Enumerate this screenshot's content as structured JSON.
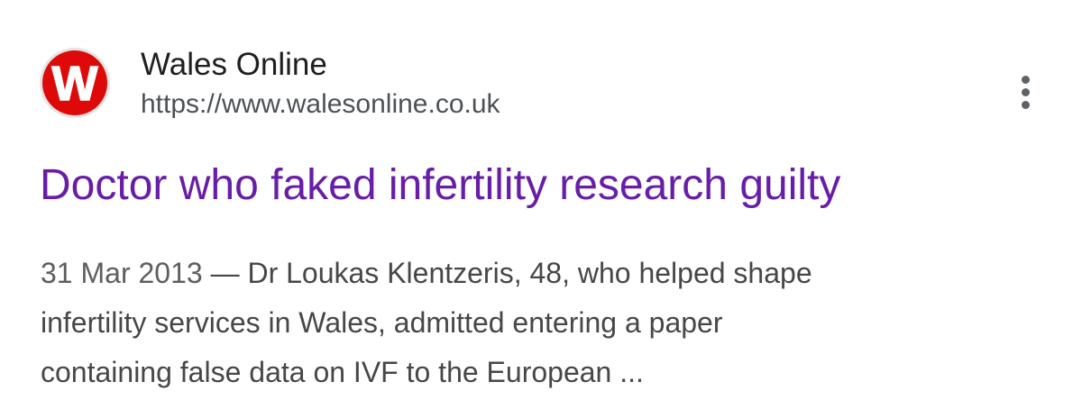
{
  "site": {
    "name": "Wales Online",
    "url": "https://www.walesonline.co.uk",
    "favicon_letter": "W",
    "favicon_icon": "wales-online-logo",
    "favicon_color": "#de0a0a"
  },
  "more_icon": "more-vert-icon",
  "result": {
    "title": "Doctor who faked infertility research guilty",
    "title_color": "#681da8"
  },
  "snippet": {
    "date": "31 Mar 2013",
    "separator": " — ",
    "lines": [
      "Dr Loukas Klentzeris, 48, who helped shape",
      "infertility services in Wales, admitted entering a paper",
      "containing false data on IVF to the European ..."
    ]
  }
}
